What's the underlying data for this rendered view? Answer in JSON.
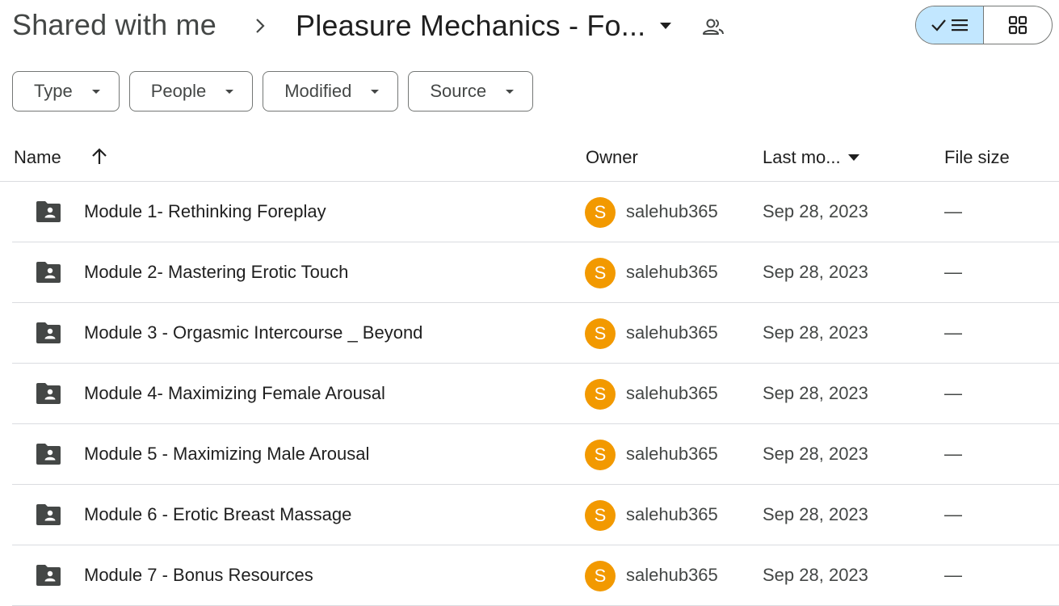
{
  "breadcrumb": {
    "root": "Shared with me",
    "current": "Pleasure Mechanics - Fo..."
  },
  "icons": {
    "separator": "chevron-right-icon",
    "caret": "caret-down-icon",
    "shared": "people-icon",
    "list_view": "check-list-icon",
    "grid_view": "grid-icon",
    "folder": "shared-folder-icon",
    "sort": "arrow-up-icon"
  },
  "view_toggle": {
    "active": "list"
  },
  "filters": [
    "Type",
    "People",
    "Modified",
    "Source"
  ],
  "columns": {
    "name": "Name",
    "owner": "Owner",
    "modified": "Last mo...",
    "size": "File size"
  },
  "rows": [
    {
      "name": "Module 1- Rethinking Foreplay",
      "avatar": "S",
      "owner": "salehub365",
      "modified": "Sep 28, 2023",
      "size": "—"
    },
    {
      "name": "Module 2- Mastering Erotic Touch",
      "avatar": "S",
      "owner": "salehub365",
      "modified": "Sep 28, 2023",
      "size": "—"
    },
    {
      "name": "Module 3 - Orgasmic Intercourse _ Beyond",
      "avatar": "S",
      "owner": "salehub365",
      "modified": "Sep 28, 2023",
      "size": "—"
    },
    {
      "name": "Module 4- Maximizing Female Arousal",
      "avatar": "S",
      "owner": "salehub365",
      "modified": "Sep 28, 2023",
      "size": "—"
    },
    {
      "name": "Module 5 - Maximizing Male Arousal",
      "avatar": "S",
      "owner": "salehub365",
      "modified": "Sep 28, 2023",
      "size": "—"
    },
    {
      "name": "Module 6 - Erotic Breast Massage",
      "avatar": "S",
      "owner": "salehub365",
      "modified": "Sep 28, 2023",
      "size": "—"
    },
    {
      "name": "Module 7 - Bonus Resources",
      "avatar": "S",
      "owner": "salehub365",
      "modified": "Sep 28, 2023",
      "size": "—"
    }
  ],
  "colors": {
    "avatar": "#f29900",
    "toggle_active": "#c2e7ff",
    "divider": "#dadce0",
    "text": "#1f1f1f",
    "secondary_text": "#444746"
  }
}
